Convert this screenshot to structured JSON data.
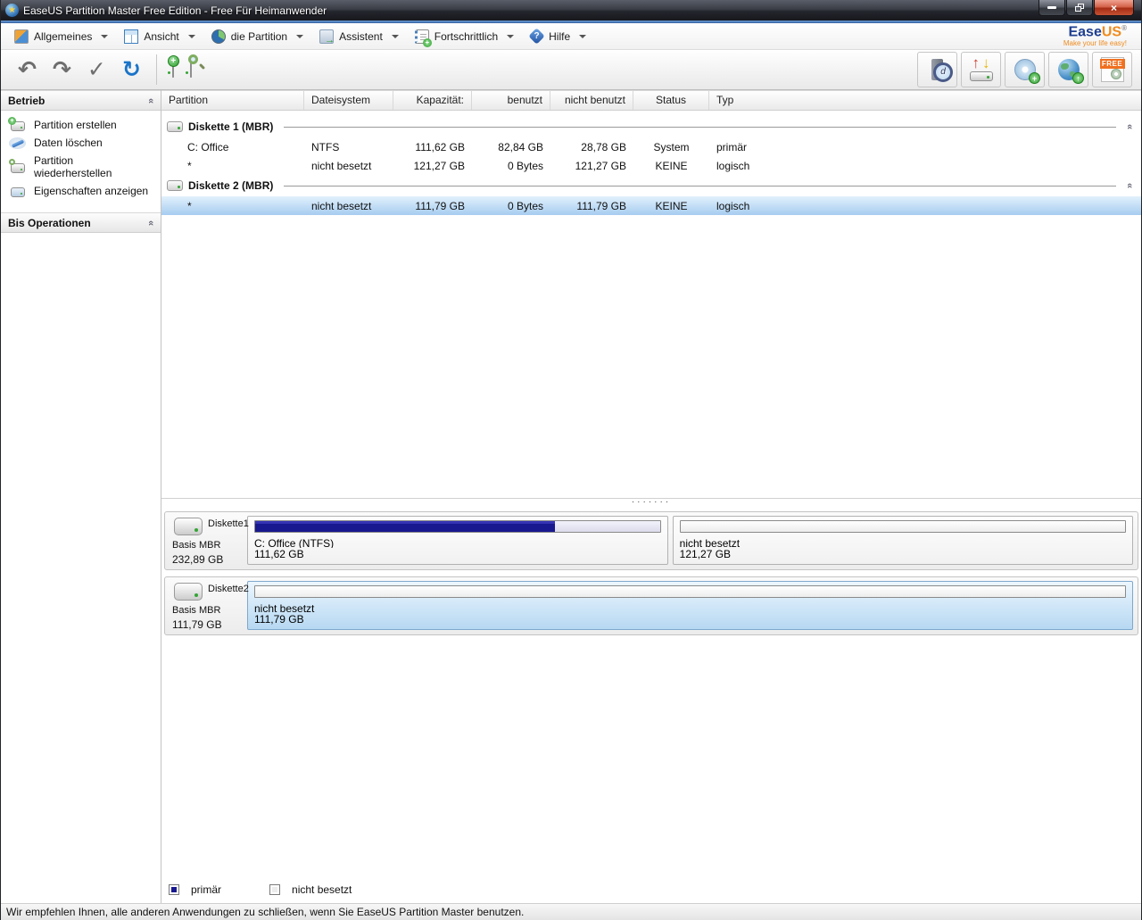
{
  "window": {
    "title": "EaseUS Partition Master Free Edition - Free Für Heimanwender",
    "app_icon_glyph": "★"
  },
  "brand": {
    "ease": "Ease",
    "us": "US",
    "reg": "®",
    "tagline": "Make your life easy!"
  },
  "menubar": {
    "items": [
      {
        "label": "Allgemeines"
      },
      {
        "label": "Ansicht"
      },
      {
        "label": "die Partition"
      },
      {
        "label": "Assistent"
      },
      {
        "label": "Fortschrittlich"
      },
      {
        "label": "Hilfe"
      }
    ]
  },
  "toolbar": {
    "free_label": "FREE"
  },
  "sidebar": {
    "sections": [
      {
        "title": "Betrieb",
        "items": [
          {
            "label": "Partition erstellen"
          },
          {
            "label": "Daten löschen"
          },
          {
            "label": "Partition wiederherstellen"
          },
          {
            "label": "Eigenschaften anzeigen"
          }
        ]
      },
      {
        "title": "Bis Operationen",
        "items": []
      }
    ]
  },
  "table": {
    "columns": [
      "Partition",
      "Dateisystem",
      "Kapazität:",
      "benutzt",
      "nicht benutzt",
      "Status",
      "Typ"
    ],
    "groups": [
      {
        "label": "Diskette 1 (MBR)",
        "rows": [
          {
            "partition": "C: Office",
            "fs": "NTFS",
            "capacity": "111,62 GB",
            "used": "82,84 GB",
            "unused": "28,78 GB",
            "status": "System",
            "type": "primär",
            "selected": false
          },
          {
            "partition": "*",
            "fs": "nicht besetzt",
            "capacity": "121,27 GB",
            "used": "0 Bytes",
            "unused": "121,27 GB",
            "status": "KEINE",
            "type": "logisch",
            "selected": false
          }
        ]
      },
      {
        "label": "Diskette 2 (MBR)",
        "rows": [
          {
            "partition": "*",
            "fs": "nicht besetzt",
            "capacity": "111,79 GB",
            "used": "0 Bytes",
            "unused": "111,79 GB",
            "status": "KEINE",
            "type": "logisch",
            "selected": true
          }
        ]
      }
    ]
  },
  "diskmap": {
    "disks": [
      {
        "name": "Diskette1",
        "scheme": "Basis MBR",
        "size": "232,89 GB",
        "partitions": [
          {
            "label": "C: Office (NTFS)",
            "size": "111,62 GB",
            "fill_percent": 74,
            "kind": "primary",
            "selected": false
          },
          {
            "label": "nicht besetzt",
            "size": "121,27 GB",
            "fill_percent": 0,
            "kind": "unallocated",
            "selected": false
          }
        ]
      },
      {
        "name": "Diskette2",
        "scheme": "Basis MBR",
        "size": "111,79 GB",
        "partitions": [
          {
            "label": "nicht besetzt",
            "size": "111,79 GB",
            "fill_percent": 0,
            "kind": "unallocated",
            "selected": true
          }
        ]
      }
    ]
  },
  "legend": {
    "items": [
      {
        "label": "primär",
        "color": "#18188f"
      },
      {
        "label": "nicht besetzt",
        "color": "#ececec"
      }
    ]
  },
  "statusbar": {
    "text": "Wir empfehlen Ihnen, alle anderen Anwendungen zu schließen, wenn Sie EaseUS Partition Master benutzen."
  }
}
